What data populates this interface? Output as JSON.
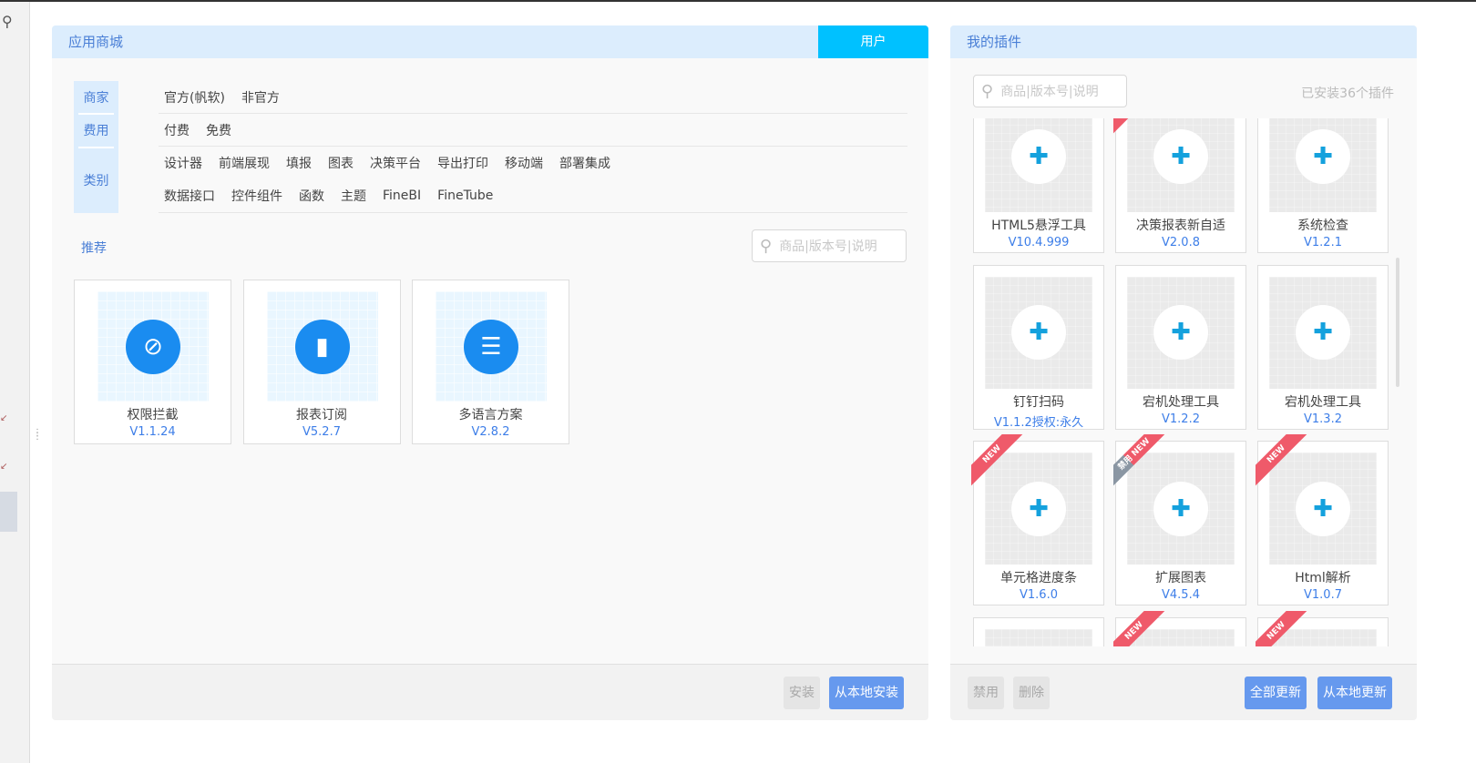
{
  "store": {
    "title": "应用商城",
    "user_button": "用户",
    "filters": {
      "labels": [
        "商家",
        "费用",
        "类别"
      ],
      "vendor": [
        "官方(帆软)",
        "非官方"
      ],
      "fee": [
        "付费",
        "免费"
      ],
      "category_row1": [
        "设计器",
        "前端展现",
        "填报",
        "图表",
        "决策平台",
        "导出打印",
        "移动端",
        "部署集成"
      ],
      "category_row2": [
        "数据接口",
        "控件组件",
        "函数",
        "主题",
        "FineBI",
        "FineTube"
      ]
    },
    "recommend_label": "推荐",
    "search_placeholder": "商品|版本号|说明",
    "recommended": [
      {
        "name": "权限拦截",
        "version": "V1.1.24",
        "icon": "shield-block-icon"
      },
      {
        "name": "报表订阅",
        "version": "V5.2.7",
        "icon": "chart-subscribe-icon"
      },
      {
        "name": "多语言方案",
        "version": "V2.8.2",
        "icon": "language-icon"
      }
    ],
    "footer": {
      "install": "安装",
      "install_local": "从本地安装"
    }
  },
  "plugins": {
    "title": "我的插件",
    "search_placeholder": "商品|版本号|说明",
    "installed_count": "已安装36个插件",
    "items": [
      {
        "name": "HTML5悬浮工具",
        "version": "V10.4.999",
        "ribbon": ""
      },
      {
        "name": "决策报表新自适",
        "version": "V2.0.8",
        "ribbon": "NEW"
      },
      {
        "name": "系统检查",
        "version": "V1.2.1",
        "ribbon": ""
      },
      {
        "name": "钉钉扫码",
        "version": "V1.1.2授权:永久",
        "ribbon": ""
      },
      {
        "name": "宕机处理工具",
        "version": "V1.2.2",
        "ribbon": ""
      },
      {
        "name": "宕机处理工具",
        "version": "V1.3.2",
        "ribbon": ""
      },
      {
        "name": "单元格进度条",
        "version": "V1.6.0",
        "ribbon": "NEW"
      },
      {
        "name": "扩展图表",
        "version": "V4.5.4",
        "ribbon": "禁用 NEW"
      },
      {
        "name": "Html解析",
        "version": "V1.0.7",
        "ribbon": "NEW"
      },
      {
        "name": "",
        "version": "",
        "ribbon": ""
      },
      {
        "name": "",
        "version": "",
        "ribbon": "NEW"
      },
      {
        "name": "",
        "version": "",
        "ribbon": "NEW"
      }
    ],
    "footer": {
      "disable": "禁用",
      "delete": "删除",
      "update_all": "全部更新",
      "update_local": "从本地更新"
    }
  }
}
